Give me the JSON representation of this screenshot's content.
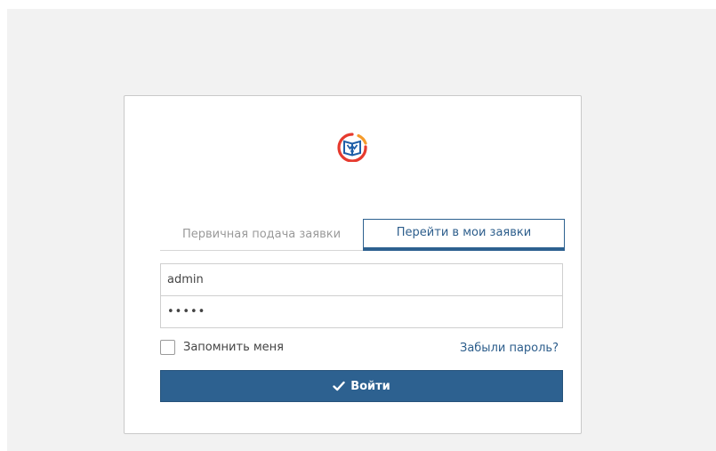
{
  "tabs": {
    "primary_label": "Первичная подача заявки",
    "my_requests_label": "Перейти в мои заявки",
    "active": "my_requests"
  },
  "form": {
    "login_value": "admin",
    "password_value": "•••••",
    "remember_label": "Запомнить меня",
    "remember_checked": false,
    "forgot_label": "Забыли пароль?",
    "submit_label": "Войти",
    "submit_icon": "check-icon"
  },
  "logo": {
    "icon": "book-logo-icon",
    "colors": {
      "ring_red": "#e63a2e",
      "ring_orange": "#f59b2b",
      "book_blue": "#1f5fa8"
    }
  },
  "colors": {
    "primary": "#2d6190",
    "background": "#f2f2f2",
    "card": "#ffffff"
  }
}
